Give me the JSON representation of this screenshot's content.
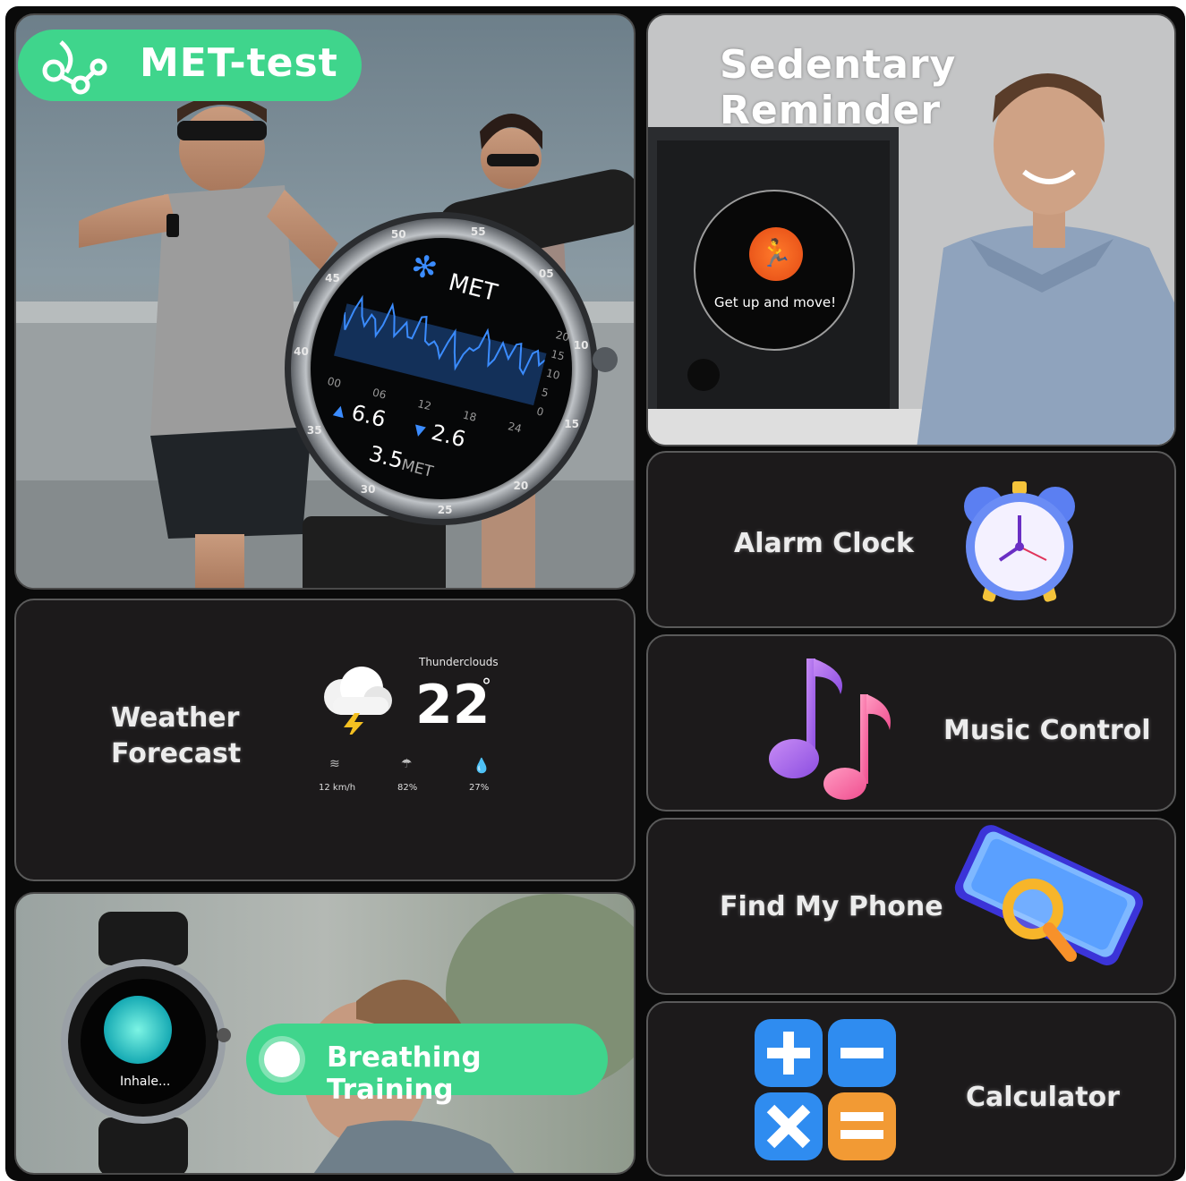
{
  "met": {
    "badge_label": "MET-test",
    "watch_title": "MET",
    "bezel_ticks": [
      "55",
      "05",
      "10",
      "15",
      "20",
      "25",
      "30",
      "35",
      "40",
      "45",
      "50"
    ],
    "hour_labels": [
      "00",
      "06",
      "12",
      "18",
      "24"
    ],
    "scale_labels": [
      "20",
      "15",
      "10",
      "5",
      "0"
    ],
    "high_value": "6.6",
    "low_value": "2.6",
    "current_value": "3.5",
    "unit": "MET"
  },
  "sedentary": {
    "title": "Sedentary Reminder",
    "popup_text": "Get up and move!"
  },
  "alarm": {
    "label": "Alarm Clock"
  },
  "weather": {
    "label_line1": "Weather",
    "label_line2": "Forecast",
    "condition": "Thunderclouds",
    "temperature": "22",
    "degree": "°",
    "wind": "12 km/h",
    "rain_chance": "82%",
    "humidity": "27%"
  },
  "music": {
    "label": "Music Control"
  },
  "phone": {
    "label": "Find My Phone"
  },
  "breathing": {
    "label": "Breathing Training",
    "watch_text": "Inhale..."
  },
  "calculator": {
    "label": "Calculator"
  },
  "colors": {
    "accent_green": "#3fd58c",
    "panel_dark": "#1c1a1b",
    "alert_orange": "#f05a1e",
    "chart_blue": "#2f7ff0"
  }
}
